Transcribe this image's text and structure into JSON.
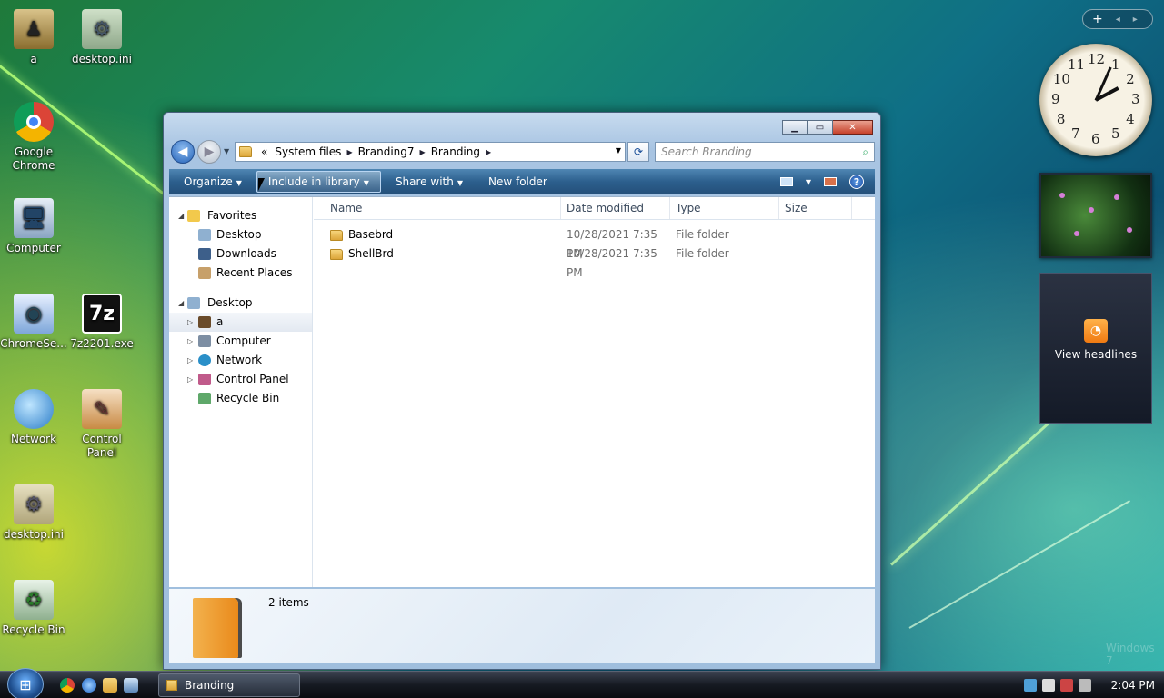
{
  "desktop": {
    "icons": [
      {
        "label": "a",
        "icon": "user-folder-icon"
      },
      {
        "label": "desktop.ini",
        "icon": "settings-file-icon"
      },
      {
        "label": "Google Chrome",
        "icon": "chrome-icon"
      },
      {
        "label": "Computer",
        "icon": "computer-icon"
      },
      {
        "label": "ChromeSe...",
        "icon": "installer-icon"
      },
      {
        "label": "7z2201.exe",
        "icon": "7zip-icon"
      },
      {
        "label": "Network",
        "icon": "network-icon"
      },
      {
        "label": "Control Panel",
        "icon": "control-panel-icon"
      },
      {
        "label": "desktop.ini",
        "icon": "settings-file-icon"
      },
      {
        "label": "Recycle Bin",
        "icon": "recycle-bin-icon"
      }
    ],
    "icon_glyphs": {
      "7zip": "7z"
    }
  },
  "window": {
    "title": "Branding",
    "address": {
      "prefix": "«",
      "crumbs": [
        "System files",
        "Branding7",
        "Branding"
      ]
    },
    "search_placeholder": "Search Branding",
    "toolbar": {
      "organize": "Organize",
      "include_in_library": "Include in library",
      "share_with": "Share with",
      "new_folder": "New folder",
      "help": "?"
    },
    "nav_pane": {
      "favorites_header": "Favorites",
      "favorites": [
        "Desktop",
        "Downloads",
        "Recent Places"
      ],
      "desktop_header": "Desktop",
      "desktop_items": [
        "a",
        "Computer",
        "Network",
        "Control Panel",
        "Recycle Bin"
      ],
      "selected": "a"
    },
    "columns": [
      "Name",
      "Date modified",
      "Type",
      "Size"
    ],
    "files": [
      {
        "name": "Basebrd",
        "date": "10/28/2021 7:35 PM",
        "type": "File folder",
        "size": ""
      },
      {
        "name": "ShellBrd",
        "date": "10/28/2021 7:35 PM",
        "type": "File folder",
        "size": ""
      }
    ],
    "details": {
      "count": "2 items"
    }
  },
  "gadgets": {
    "controls": {
      "add": "+",
      "prev": "◂",
      "next": "▸"
    },
    "clock": {
      "hour": 2,
      "minute": 4
    },
    "feed_label": "View headlines"
  },
  "taskbar": {
    "task": "Branding",
    "time": "2:04 PM"
  },
  "watermark": "Windows 7"
}
